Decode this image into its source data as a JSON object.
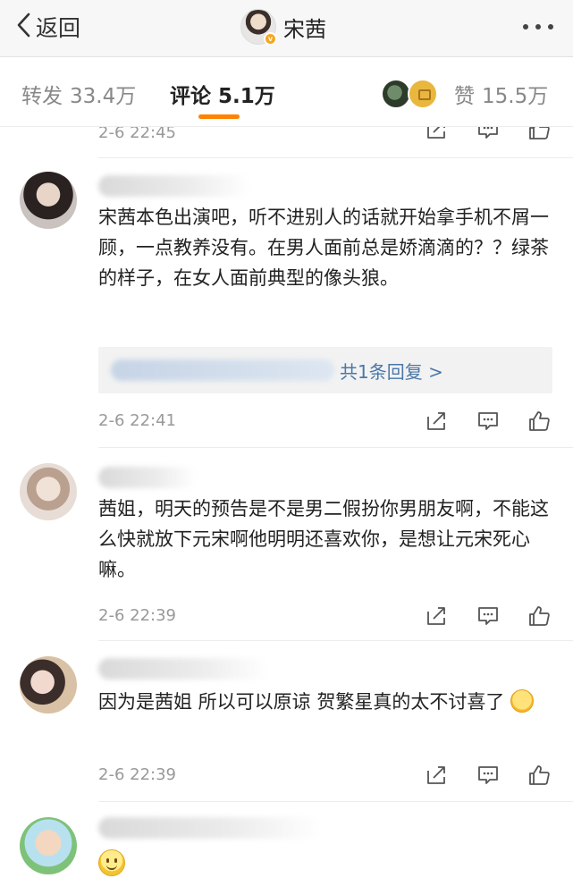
{
  "navbar": {
    "back_label": "返回",
    "user_name": "宋茜",
    "verified_badge": "v",
    "more_icon": "more-dots-icon"
  },
  "tabs": {
    "repost_label": "转发",
    "repost_count": "33.4万",
    "comment_label": "评论",
    "comment_count": "5.1万",
    "like_label": "赞",
    "like_count": "15.5万",
    "active": "comment",
    "accent_color": "#ff8200"
  },
  "comments": [
    {
      "time": "2-6 22:45"
    },
    {
      "text": "宋茜本色出演吧，听不进别人的话就开始拿手机不屑一顾，一点教养没有。在男人面前总是娇滴滴的？？绿茶的样子，在女人面前典型的像头狼。",
      "reply_link": "共1条回复 >",
      "time": "2-6 22:41"
    },
    {
      "text": "茜姐，明天的预告是不是男二假扮你男朋友啊，不能这么快就放下元宋啊他明明还喜欢你，是想让元宋死心嘛。",
      "time": "2-6 22:39"
    },
    {
      "text": "因为是茜姐 所以可以原谅 贺繁星真的太不讨喜了",
      "emoji": "thinking-emoji",
      "time": "2-6 22:39"
    },
    {
      "emoji": "smile-emoji"
    }
  ],
  "action_icons": [
    "repost-icon",
    "comment-icon",
    "like-icon"
  ]
}
